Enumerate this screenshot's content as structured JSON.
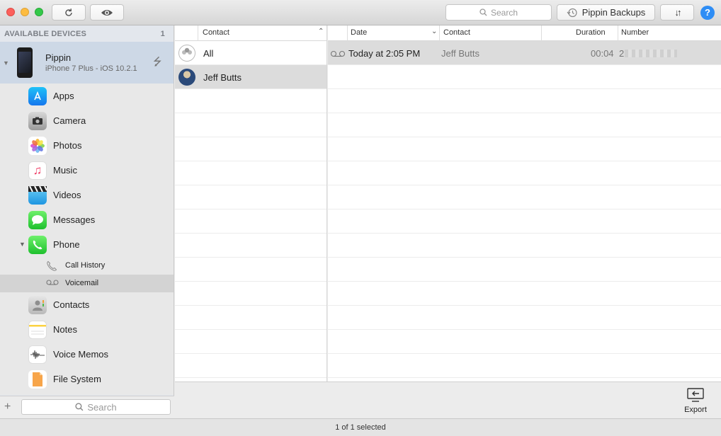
{
  "toolbar": {
    "search_placeholder": "Search",
    "backups_label": "Pippin Backups",
    "transfer_label": "↓↑",
    "help_label": "?"
  },
  "sidebar": {
    "header": "AVAILABLE DEVICES",
    "count": "1",
    "device": {
      "name": "Pippin",
      "model": "iPhone 7 Plus - iOS 10.2.1"
    },
    "items": [
      {
        "label": "Apps",
        "icon": "app-store-icon"
      },
      {
        "label": "Camera",
        "icon": "camera-icon"
      },
      {
        "label": "Photos",
        "icon": "photos-icon"
      },
      {
        "label": "Music",
        "icon": "music-icon"
      },
      {
        "label": "Videos",
        "icon": "videos-icon"
      },
      {
        "label": "Messages",
        "icon": "messages-icon"
      },
      {
        "label": "Phone",
        "icon": "phone-icon"
      },
      {
        "label": "Contacts",
        "icon": "contacts-icon"
      },
      {
        "label": "Notes",
        "icon": "notes-icon"
      },
      {
        "label": "Voice Memos",
        "icon": "voice-memos-icon"
      },
      {
        "label": "File System",
        "icon": "file-system-icon"
      }
    ],
    "phone_sub": [
      {
        "label": "Call History",
        "icon": "phone-handset-icon"
      },
      {
        "label": "Voicemail",
        "icon": "voicemail-icon",
        "selected": true
      }
    ],
    "search_placeholder": "Search"
  },
  "contacts_column": {
    "header": "Contact",
    "rows": [
      {
        "label": "All"
      },
      {
        "label": "Jeff Butts",
        "selected": true
      }
    ]
  },
  "voicemail_table": {
    "headers": {
      "date": "Date",
      "contact": "Contact",
      "duration": "Duration",
      "number": "Number"
    },
    "rows": [
      {
        "date": "Today at 2:05 PM",
        "contact": "Jeff Butts",
        "duration": "00:04",
        "number_prefix": "2"
      }
    ]
  },
  "export_label": "Export",
  "status_text": "1 of 1 selected"
}
